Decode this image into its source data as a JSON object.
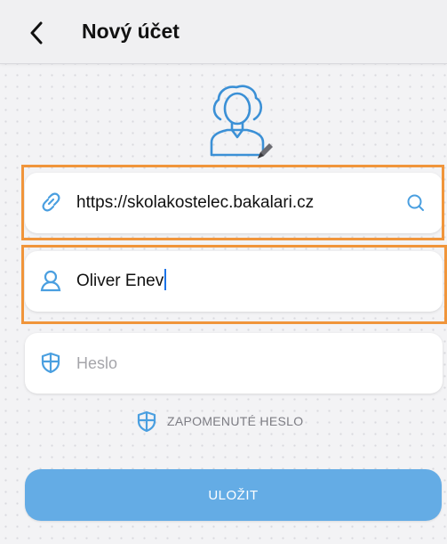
{
  "header": {
    "title": "Nový účet",
    "back_icon": "chevron-left-icon"
  },
  "avatar": {
    "icon": "user-avatar-icon",
    "edit_icon": "pencil-icon"
  },
  "fields": {
    "url": {
      "icon": "link-icon",
      "value": "https://skolakostelec.bakalari.cz",
      "action_icon": "search-icon"
    },
    "username": {
      "icon": "user-icon",
      "value": "Oliver Enev"
    },
    "password": {
      "icon": "shield-icon",
      "placeholder": "Heslo",
      "value": ""
    }
  },
  "forgot_password": {
    "icon": "shield-icon",
    "label": "ZAPOMENUTÉ HESLO"
  },
  "save_button": {
    "label": "ULOŽIT"
  },
  "colors": {
    "accent": "#4a9fe0",
    "button": "#64ace5",
    "highlight": "#f0953b"
  }
}
